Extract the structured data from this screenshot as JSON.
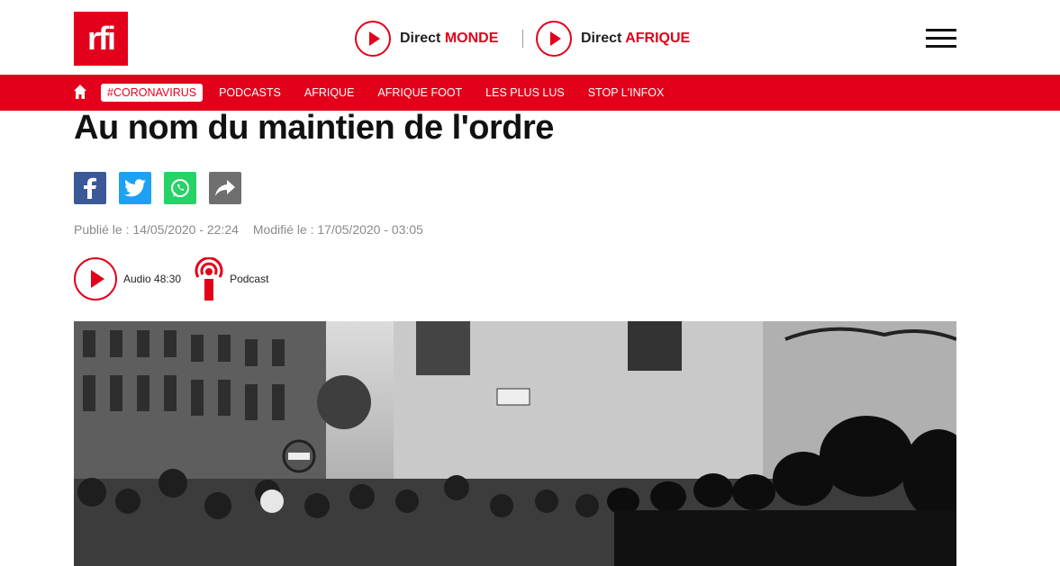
{
  "header": {
    "logo_text": "rfi",
    "direct_monde": {
      "prefix": "Direct",
      "region": "MONDE"
    },
    "direct_afrique": {
      "prefix": "Direct",
      "region": "AFRIQUE"
    }
  },
  "nav": {
    "items": [
      {
        "label": "#CORONAVIRUS"
      },
      {
        "label": "PODCASTS"
      },
      {
        "label": "AFRIQUE"
      },
      {
        "label": "AFRIQUE FOOT"
      },
      {
        "label": "LES PLUS LUS"
      },
      {
        "label": "STOP L'INFOX"
      }
    ]
  },
  "article": {
    "title": "Au nom du maintien de l'ordre",
    "published": "Publié le : 14/05/2020 - 22:24",
    "modified": "Modifié le : 17/05/2020 - 03:05",
    "audio_label": "Audio 48:30",
    "podcast_label": "Podcast"
  },
  "colors": {
    "brand": "#e2001a",
    "facebook": "#3b5998",
    "twitter": "#1da1f2",
    "whatsapp": "#25d366",
    "share": "#6f6f6f"
  },
  "icons": [
    "home-icon",
    "facebook-icon",
    "twitter-icon",
    "whatsapp-icon",
    "share-icon",
    "play-icon",
    "podcast-icon",
    "menu-icon"
  ]
}
